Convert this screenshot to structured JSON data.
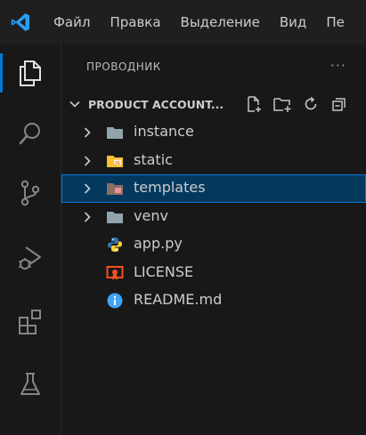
{
  "menu": [
    "Файл",
    "Правка",
    "Выделение",
    "Вид",
    "Пе"
  ],
  "explorer": {
    "title": "ПРОВОДНИК",
    "more": "···",
    "section_title": "PRODUCT ACCOUNT...",
    "items": [
      {
        "label": "instance",
        "type": "folder",
        "icon": "folder-icon"
      },
      {
        "label": "static",
        "type": "folder",
        "icon": "folder-static-icon"
      },
      {
        "label": "templates",
        "type": "folder",
        "icon": "folder-templates-icon",
        "selected": true
      },
      {
        "label": "venv",
        "type": "folder",
        "icon": "folder-icon"
      },
      {
        "label": "app.py",
        "type": "file",
        "icon": "python-icon"
      },
      {
        "label": "LICENSE",
        "type": "file",
        "icon": "license-icon"
      },
      {
        "label": "README.md",
        "type": "file",
        "icon": "info-icon"
      }
    ]
  },
  "colors": {
    "accent": "#0078d4",
    "selection_bg": "#04395e",
    "background": "#181818",
    "titlebar": "#1f1f1f"
  }
}
